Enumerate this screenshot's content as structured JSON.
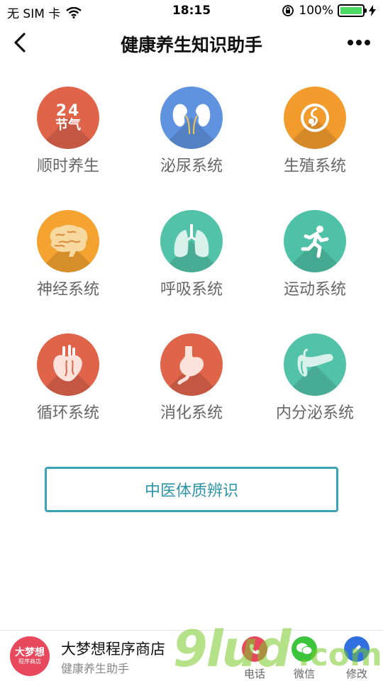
{
  "status_bar": {
    "carrier": "无 SIM 卡",
    "time": "18:15",
    "battery": "100%"
  },
  "nav": {
    "title": "健康养生知识助手"
  },
  "grid": {
    "items": [
      {
        "label": "顺时养生",
        "icon": "24-solar-terms-icon",
        "color": "#e0644a",
        "icon_text_top": "24",
        "icon_text_bottom": "节气"
      },
      {
        "label": "泌尿系统",
        "icon": "kidney-icon",
        "color": "#5f93e0"
      },
      {
        "label": "生殖系统",
        "icon": "reproductive-icon",
        "color": "#f39c2e"
      },
      {
        "label": "神经系统",
        "icon": "brain-icon",
        "color": "#f4a230"
      },
      {
        "label": "呼吸系统",
        "icon": "lungs-icon",
        "color": "#52c3a8"
      },
      {
        "label": "运动系统",
        "icon": "running-person-icon",
        "color": "#4fc1a6"
      },
      {
        "label": "循环系统",
        "icon": "heart-icon",
        "color": "#e0644a"
      },
      {
        "label": "消化系统",
        "icon": "stomach-icon",
        "color": "#e0644a"
      },
      {
        "label": "内分泌系统",
        "icon": "pancreas-icon",
        "color": "#52c3a8"
      }
    ]
  },
  "tcm_button": {
    "label": "中医体质辨识"
  },
  "footer": {
    "logo_text": "大梦想",
    "logo_subtext": "程序商店",
    "name": "大梦想程序商店",
    "subtitle": "健康养生助手",
    "actions": [
      {
        "label": "电话",
        "icon": "phone-icon",
        "color": "#e8485b"
      },
      {
        "label": "微信",
        "icon": "wechat-icon",
        "color": "#3cc43c"
      },
      {
        "label": "修改",
        "icon": "edit-icon",
        "color": "#2f6fe0"
      }
    ]
  },
  "watermark": {
    "text": "9lud",
    "suffix": ".com"
  }
}
